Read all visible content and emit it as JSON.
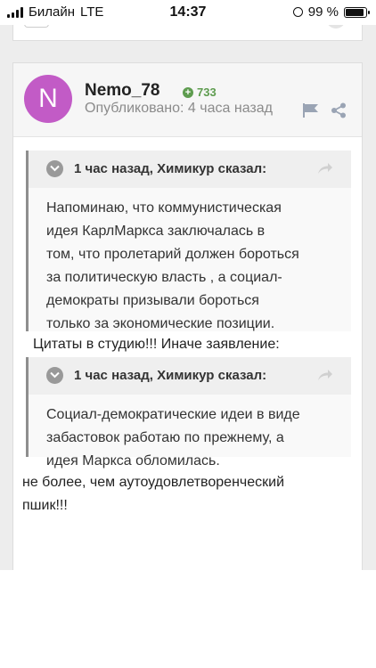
{
  "status_bar": {
    "carrier": "Билайн",
    "network": "LTE",
    "time": "14:37",
    "battery": "99 %",
    "battery_level": 0.99
  },
  "post": {
    "avatar_letter": "N",
    "avatar_color": "#c25bc6",
    "author": "Nemo_78",
    "reputation": "733",
    "published": "Опубликовано: 4 часа назад",
    "icons": [
      "flag-icon",
      "share-icon"
    ],
    "quotes": [
      {
        "citation": "1 час назад, Химикур сказал:",
        "lines": [
          "Напоминаю, что  коммунистическая",
          "идея  КарлМаркса  заключалась в",
          "том, что пролетарий должен  бороться",
          "за политическую власть ,  а  социал-",
          "демократы  призывали бороться",
          "только за экономические  позиции."
        ]
      },
      {
        "citation": "1 час назад, Химикур сказал:",
        "lines": [
          "Социал-демократические идеи в виде",
          "забастовок работаю по прежнему, а",
          "идея Маркса обломилась."
        ]
      }
    ],
    "text_after_first_quote": "Цитаты в студию!!! Иначе заявление:",
    "closing_lines": [
      "не более, чем аутоудовлетворенческий",
      "пшик!!!"
    ]
  }
}
